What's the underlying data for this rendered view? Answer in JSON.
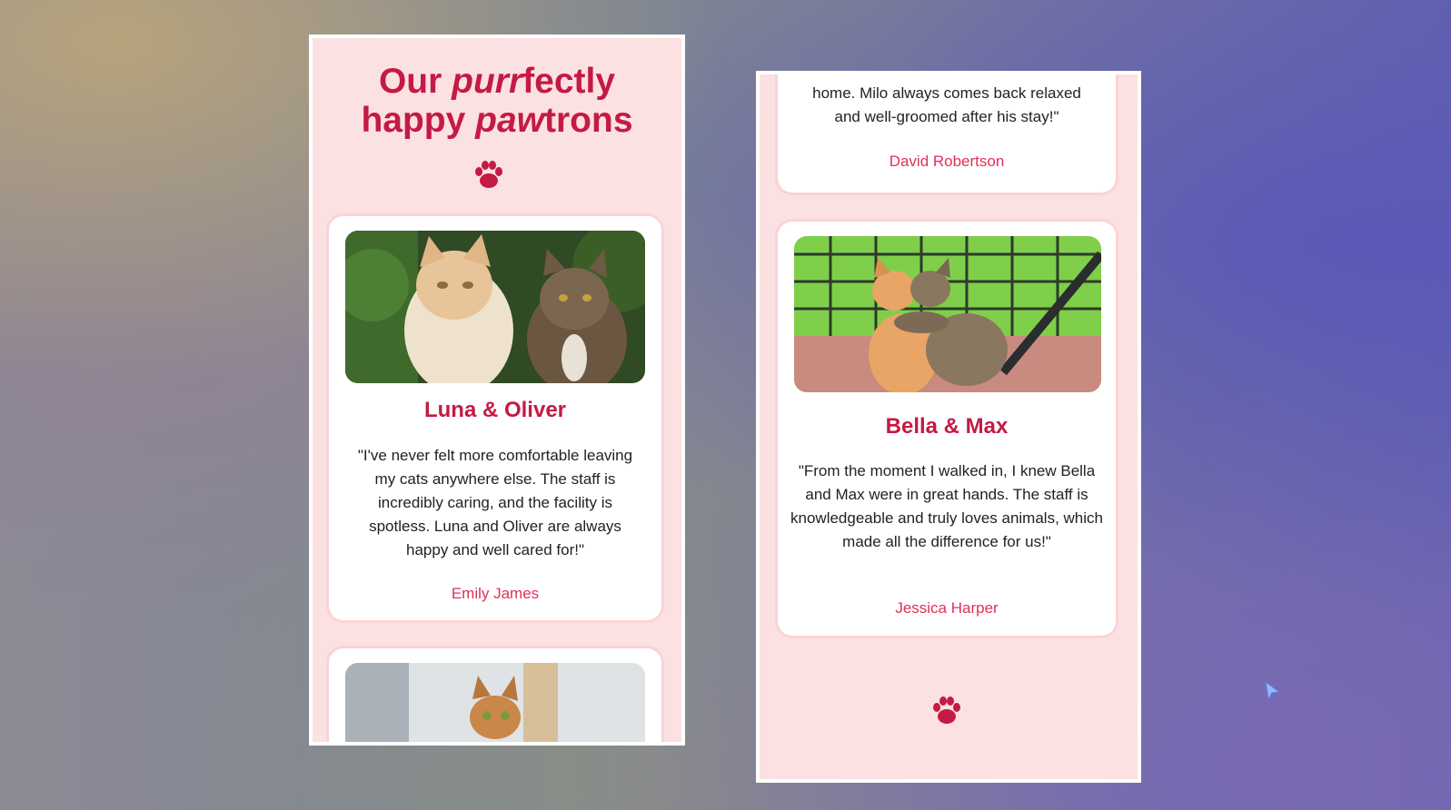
{
  "left_screen": {
    "title_line1_a": "Our ",
    "title_line1_em": "purr",
    "title_line1_b": "fectly",
    "title_line2_a": "happy ",
    "title_line2_em": "paw",
    "title_line2_b": "trons",
    "paw_icon": "paw-icon",
    "card1": {
      "image": "two-cats-photo",
      "name": "Luna & Oliver",
      "quote": "\"I've never felt more comfortable leaving my cats anywhere else. The staff is incredibly caring, and the facility is spotless. Luna and Oliver are always happy and well cared for!\"",
      "author": "Emily James"
    },
    "card2": {
      "image": "cat-scratching-post-photo"
    }
  },
  "right_screen": {
    "card_partial": {
      "quote_tail_1": "home. Milo always comes back relaxed",
      "quote_tail_2": "and well-groomed after his stay!\"",
      "author": "David Robertson"
    },
    "card3": {
      "image": "two-kittens-hugging-photo",
      "name": "Bella & Max",
      "quote": "\"From the moment I walked in, I knew Bella and Max were in great hands. The staff is knowledgeable and truly loves animals, which made all the difference for us!\"",
      "author": "Jessica Harper"
    },
    "paw_icon": "paw-icon"
  },
  "colors": {
    "accent": "#c41a44",
    "author": "#e0305a",
    "screen_bg": "#fce1e2",
    "card_bg": "#ffffff"
  }
}
